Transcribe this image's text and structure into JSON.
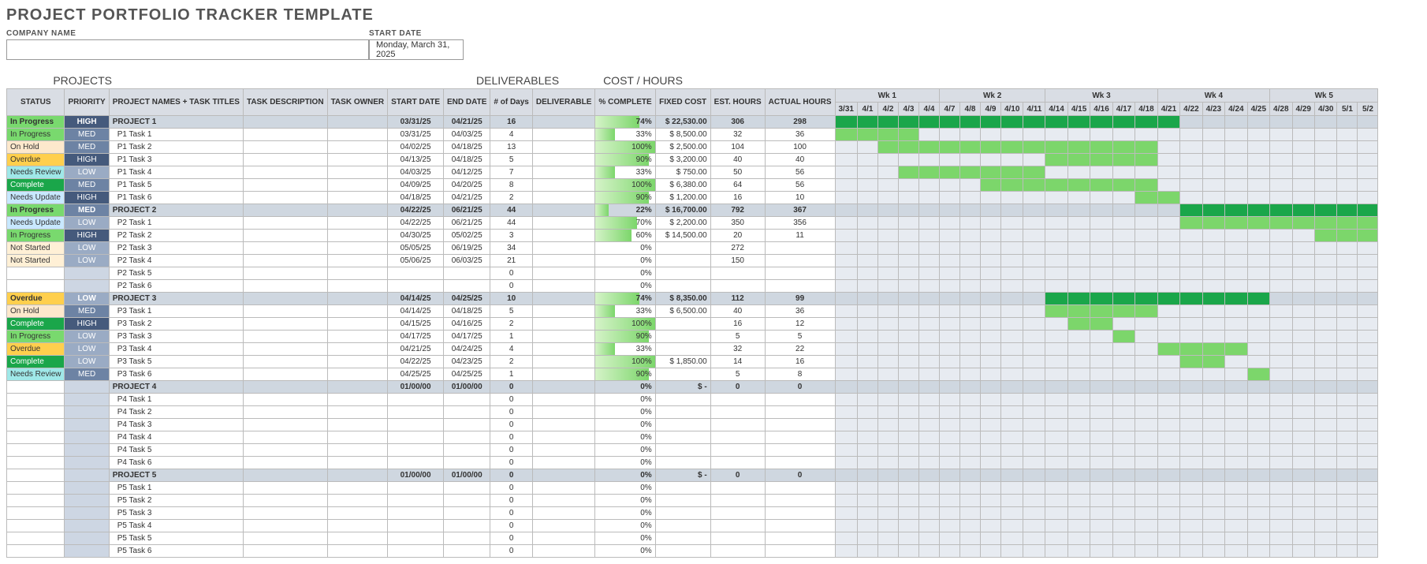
{
  "title": "PROJECT PORTFOLIO TRACKER TEMPLATE",
  "labels": {
    "company_name": "COMPANY NAME",
    "start_date": "START DATE"
  },
  "company_name_value": "",
  "start_date_value": "Monday, March 31, 2025",
  "sections": {
    "projects": "PROJECTS",
    "deliverables": "DELIVERABLES",
    "cost_hours": "COST / HOURS"
  },
  "columns": {
    "status": "STATUS",
    "priority": "PRIORITY",
    "name": "PROJECT NAMES + TASK TITLES",
    "desc": "TASK DESCRIPTION",
    "owner": "TASK OWNER",
    "sdate": "START DATE",
    "edate": "END DATE",
    "days": "# of Days",
    "deliv": "DELIVERABLE",
    "pct": "% COMPLETE",
    "cost": "FIXED COST",
    "esth": "EST. HOURS",
    "acth": "ACTUAL HOURS"
  },
  "weeks": [
    {
      "label": "Wk 1",
      "days": [
        "3/31",
        "4/1",
        "4/2",
        "4/3",
        "4/4"
      ]
    },
    {
      "label": "Wk 2",
      "days": [
        "4/7",
        "4/8",
        "4/9",
        "4/10",
        "4/11"
      ]
    },
    {
      "label": "Wk 3",
      "days": [
        "4/14",
        "4/15",
        "4/16",
        "4/17",
        "4/18"
      ]
    },
    {
      "label": "Wk 4",
      "days": [
        "4/21",
        "4/22",
        "4/23",
        "4/24",
        "4/25"
      ]
    },
    {
      "label": "Wk 5",
      "days": [
        "4/28",
        "4/29",
        "4/30",
        "5/1",
        "5/2"
      ]
    }
  ],
  "rows": [
    {
      "type": "project",
      "status": "In Progress",
      "priority": "HIGH",
      "name": "PROJECT 1",
      "sdate": "03/31/25",
      "edate": "04/21/25",
      "days": "16",
      "pct": 74,
      "cost": "$      22,530.00",
      "esth": "306",
      "acth": "298",
      "bar": [
        0,
        15
      ]
    },
    {
      "type": "task",
      "status": "In Progress",
      "priority": "MED",
      "name": "P1 Task 1",
      "sdate": "03/31/25",
      "edate": "04/03/25",
      "days": "4",
      "pct": 33,
      "cost": "$        8,500.00",
      "esth": "32",
      "acth": "36",
      "bar": [
        0,
        3
      ]
    },
    {
      "type": "task",
      "status": "On Hold",
      "priority": "MED",
      "name": "P1 Task 2",
      "sdate": "04/02/25",
      "edate": "04/18/25",
      "days": "13",
      "pct": 100,
      "cost": "$        2,500.00",
      "esth": "104",
      "acth": "100",
      "bar": [
        2,
        14
      ]
    },
    {
      "type": "task",
      "status": "Overdue",
      "priority": "HIGH",
      "name": "P1 Task 3",
      "sdate": "04/13/25",
      "edate": "04/18/25",
      "days": "5",
      "pct": 90,
      "cost": "$        3,200.00",
      "esth": "40",
      "acth": "40",
      "bar": [
        10,
        14
      ]
    },
    {
      "type": "task",
      "status": "Needs Review",
      "priority": "LOW",
      "name": "P1 Task 4",
      "sdate": "04/03/25",
      "edate": "04/12/25",
      "days": "7",
      "pct": 33,
      "cost": "$           750.00",
      "esth": "50",
      "acth": "56",
      "bar": [
        3,
        9
      ]
    },
    {
      "type": "task",
      "status": "Complete",
      "priority": "MED",
      "name": "P1 Task 5",
      "sdate": "04/09/25",
      "edate": "04/20/25",
      "days": "8",
      "pct": 100,
      "cost": "$        6,380.00",
      "esth": "64",
      "acth": "56",
      "bar": [
        7,
        14
      ]
    },
    {
      "type": "task",
      "status": "Needs Update",
      "priority": "HIGH",
      "name": "P1 Task 6",
      "sdate": "04/18/25",
      "edate": "04/21/25",
      "days": "2",
      "pct": 90,
      "cost": "$        1,200.00",
      "esth": "16",
      "acth": "10",
      "bar": [
        14,
        15
      ]
    },
    {
      "type": "project",
      "status": "In Progress",
      "priority": "MED",
      "name": "PROJECT 2",
      "sdate": "04/22/25",
      "edate": "06/21/25",
      "days": "44",
      "pct": 22,
      "cost": "$      16,700.00",
      "esth": "792",
      "acth": "367",
      "bar": [
        16,
        24
      ]
    },
    {
      "type": "task",
      "status": "Needs Update",
      "priority": "LOW",
      "name": "P2 Task 1",
      "sdate": "04/22/25",
      "edate": "06/21/25",
      "days": "44",
      "pct": 70,
      "cost": "$        2,200.00",
      "esth": "350",
      "acth": "356",
      "bar": [
        16,
        24
      ]
    },
    {
      "type": "task",
      "status": "In Progress",
      "priority": "HIGH",
      "name": "P2 Task 2",
      "sdate": "04/30/25",
      "edate": "05/02/25",
      "days": "3",
      "pct": 60,
      "cost": "$      14,500.00",
      "esth": "20",
      "acth": "11",
      "bar": [
        22,
        24
      ]
    },
    {
      "type": "task",
      "status": "Not Started",
      "priority": "LOW",
      "name": "P2 Task 3",
      "sdate": "05/05/25",
      "edate": "06/19/25",
      "days": "34",
      "pct": 0,
      "cost": "",
      "esth": "272",
      "acth": "",
      "bar": null
    },
    {
      "type": "task",
      "status": "Not Started",
      "priority": "LOW",
      "name": "P2 Task 4",
      "sdate": "05/06/25",
      "edate": "06/03/25",
      "days": "21",
      "pct": 0,
      "cost": "",
      "esth": "150",
      "acth": "",
      "bar": null
    },
    {
      "type": "task",
      "status": "",
      "priority": "",
      "name": "P2 Task 5",
      "sdate": "",
      "edate": "",
      "days": "0",
      "pct": 0,
      "cost": "",
      "esth": "",
      "acth": "",
      "bar": null
    },
    {
      "type": "task",
      "status": "",
      "priority": "",
      "name": "P2 Task 6",
      "sdate": "",
      "edate": "",
      "days": "0",
      "pct": 0,
      "cost": "",
      "esth": "",
      "acth": "",
      "bar": null
    },
    {
      "type": "project",
      "status": "Overdue",
      "priority": "LOW",
      "name": "PROJECT 3",
      "sdate": "04/14/25",
      "edate": "04/25/25",
      "days": "10",
      "pct": 74,
      "cost": "$        8,350.00",
      "esth": "112",
      "acth": "99",
      "bar": [
        10,
        19
      ]
    },
    {
      "type": "task",
      "status": "On Hold",
      "priority": "MED",
      "name": "P3 Task 1",
      "sdate": "04/14/25",
      "edate": "04/18/25",
      "days": "5",
      "pct": 33,
      "cost": "$        6,500.00",
      "esth": "40",
      "acth": "36",
      "bar": [
        10,
        14
      ]
    },
    {
      "type": "task",
      "status": "Complete",
      "priority": "HIGH",
      "name": "P3 Task 2",
      "sdate": "04/15/25",
      "edate": "04/16/25",
      "days": "2",
      "pct": 100,
      "cost": "",
      "esth": "16",
      "acth": "12",
      "bar": [
        11,
        12
      ]
    },
    {
      "type": "task",
      "status": "In Progress",
      "priority": "LOW",
      "name": "P3 Task 3",
      "sdate": "04/17/25",
      "edate": "04/17/25",
      "days": "1",
      "pct": 90,
      "cost": "",
      "esth": "5",
      "acth": "5",
      "bar": [
        13,
        13
      ]
    },
    {
      "type": "task",
      "status": "Overdue",
      "priority": "LOW",
      "name": "P3 Task 4",
      "sdate": "04/21/25",
      "edate": "04/24/25",
      "days": "4",
      "pct": 33,
      "cost": "",
      "esth": "32",
      "acth": "22",
      "bar": [
        15,
        18
      ]
    },
    {
      "type": "task",
      "status": "Complete",
      "priority": "LOW",
      "name": "P3 Task 5",
      "sdate": "04/22/25",
      "edate": "04/23/25",
      "days": "2",
      "pct": 100,
      "cost": "$        1,850.00",
      "esth": "14",
      "acth": "16",
      "bar": [
        16,
        17
      ]
    },
    {
      "type": "task",
      "status": "Needs Review",
      "priority": "MED",
      "name": "P3 Task 6",
      "sdate": "04/25/25",
      "edate": "04/25/25",
      "days": "1",
      "pct": 90,
      "cost": "",
      "esth": "5",
      "acth": "8",
      "bar": [
        19,
        19
      ]
    },
    {
      "type": "project",
      "status": "",
      "priority": "",
      "name": "PROJECT 4",
      "sdate": "01/00/00",
      "edate": "01/00/00",
      "days": "0",
      "pct": 0,
      "cost": "$             -",
      "esth": "0",
      "acth": "0",
      "bar": null
    },
    {
      "type": "task",
      "status": "",
      "priority": "",
      "name": "P4 Task 1",
      "sdate": "",
      "edate": "",
      "days": "0",
      "pct": 0,
      "cost": "",
      "esth": "",
      "acth": "",
      "bar": null
    },
    {
      "type": "task",
      "status": "",
      "priority": "",
      "name": "P4 Task 2",
      "sdate": "",
      "edate": "",
      "days": "0",
      "pct": 0,
      "cost": "",
      "esth": "",
      "acth": "",
      "bar": null
    },
    {
      "type": "task",
      "status": "",
      "priority": "",
      "name": "P4 Task 3",
      "sdate": "",
      "edate": "",
      "days": "0",
      "pct": 0,
      "cost": "",
      "esth": "",
      "acth": "",
      "bar": null
    },
    {
      "type": "task",
      "status": "",
      "priority": "",
      "name": "P4 Task 4",
      "sdate": "",
      "edate": "",
      "days": "0",
      "pct": 0,
      "cost": "",
      "esth": "",
      "acth": "",
      "bar": null
    },
    {
      "type": "task",
      "status": "",
      "priority": "",
      "name": "P4 Task 5",
      "sdate": "",
      "edate": "",
      "days": "0",
      "pct": 0,
      "cost": "",
      "esth": "",
      "acth": "",
      "bar": null
    },
    {
      "type": "task",
      "status": "",
      "priority": "",
      "name": "P4 Task 6",
      "sdate": "",
      "edate": "",
      "days": "0",
      "pct": 0,
      "cost": "",
      "esth": "",
      "acth": "",
      "bar": null
    },
    {
      "type": "project",
      "status": "",
      "priority": "",
      "name": "PROJECT 5",
      "sdate": "01/00/00",
      "edate": "01/00/00",
      "days": "0",
      "pct": 0,
      "cost": "$             -",
      "esth": "0",
      "acth": "0",
      "bar": null
    },
    {
      "type": "task",
      "status": "",
      "priority": "",
      "name": "P5 Task 1",
      "sdate": "",
      "edate": "",
      "days": "0",
      "pct": 0,
      "cost": "",
      "esth": "",
      "acth": "",
      "bar": null
    },
    {
      "type": "task",
      "status": "",
      "priority": "",
      "name": "P5 Task 2",
      "sdate": "",
      "edate": "",
      "days": "0",
      "pct": 0,
      "cost": "",
      "esth": "",
      "acth": "",
      "bar": null
    },
    {
      "type": "task",
      "status": "",
      "priority": "",
      "name": "P5 Task 3",
      "sdate": "",
      "edate": "",
      "days": "0",
      "pct": 0,
      "cost": "",
      "esth": "",
      "acth": "",
      "bar": null
    },
    {
      "type": "task",
      "status": "",
      "priority": "",
      "name": "P5 Task 4",
      "sdate": "",
      "edate": "",
      "days": "0",
      "pct": 0,
      "cost": "",
      "esth": "",
      "acth": "",
      "bar": null
    },
    {
      "type": "task",
      "status": "",
      "priority": "",
      "name": "P5 Task 5",
      "sdate": "",
      "edate": "",
      "days": "0",
      "pct": 0,
      "cost": "",
      "esth": "",
      "acth": "",
      "bar": null
    },
    {
      "type": "task",
      "status": "",
      "priority": "",
      "name": "P5 Task 6",
      "sdate": "",
      "edate": "",
      "days": "0",
      "pct": 0,
      "cost": "",
      "esth": "",
      "acth": "",
      "bar": null
    }
  ]
}
